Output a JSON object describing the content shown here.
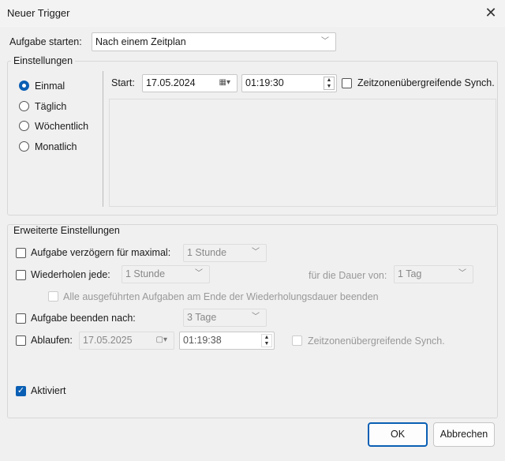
{
  "window": {
    "title": "Neuer Trigger",
    "close": "✕"
  },
  "start_task": {
    "label": "Aufgabe starten:",
    "value": "Nach einem Zeitplan"
  },
  "settings": {
    "title": "Einstellungen",
    "radios": [
      {
        "label": "Einmal",
        "checked": true
      },
      {
        "label": "Täglich"
      },
      {
        "label": "Wöchentlich"
      },
      {
        "label": "Monatlich"
      }
    ],
    "start_label": "Start:",
    "start_date": "17.05.2024",
    "start_time": "01:19:30",
    "sync_label": "Zeitzonenübergreifende Synch."
  },
  "advanced": {
    "title": "Erweiterte Einstellungen",
    "delay_label": "Aufgabe verzögern für maximal:",
    "delay_value": "1 Stunde",
    "repeat_label": "Wiederholen jede:",
    "repeat_value": "1 Stunde",
    "duration_label": "für die Dauer von:",
    "duration_value": "1 Tag",
    "stop_all_label": "Alle ausgeführten Aufgaben am Ende der Wiederholungsdauer beenden",
    "end_label": "Aufgabe beenden nach:",
    "end_value": "3 Tage",
    "expire_label": "Ablaufen:",
    "expire_date": "17.05.2025",
    "expire_time": "01:19:38",
    "expire_sync_label": "Zeitzonenübergreifende Synch."
  },
  "enabled": {
    "label": "Aktiviert",
    "checked": true
  },
  "buttons": {
    "ok": "OK",
    "cancel": "Abbrechen"
  }
}
